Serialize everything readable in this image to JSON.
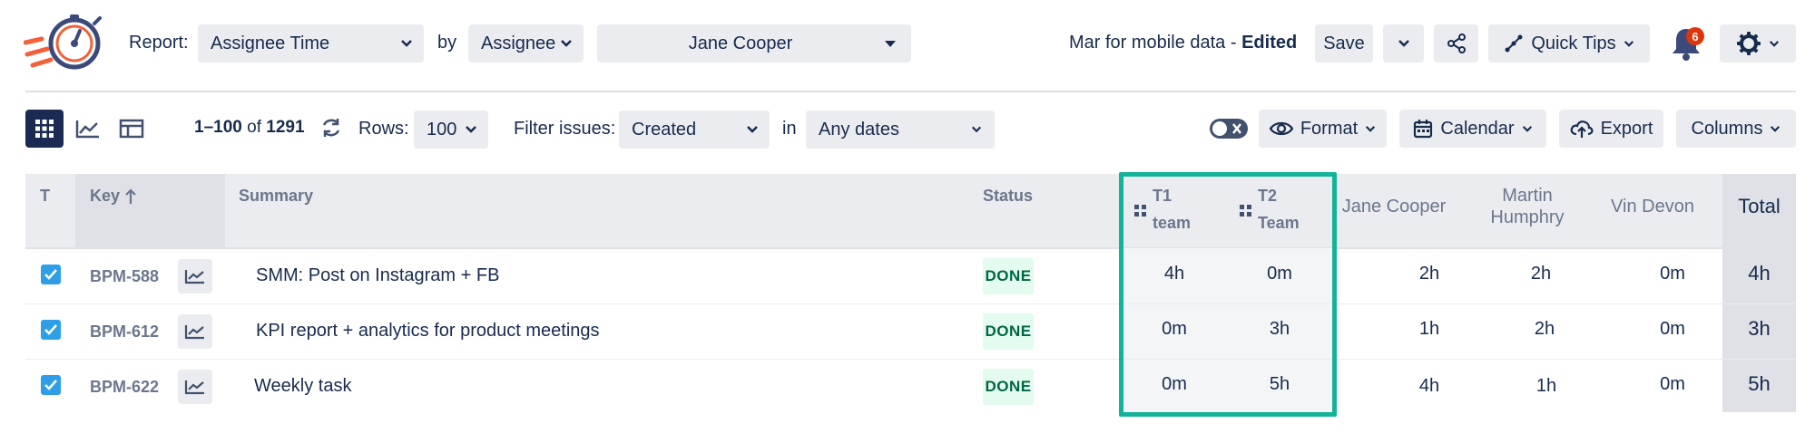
{
  "header": {
    "report_label": "Report:",
    "report_value": "Assignee Time",
    "by_label": "by",
    "by_value": "Assignee",
    "person_value": "Jane Cooper",
    "report_name": "Mar for mobile data - ",
    "report_status": "Edited",
    "save_label": "Save",
    "quick_tips_label": "Quick Tips",
    "notification_count": "6"
  },
  "toolbar": {
    "range_start": "1–100",
    "range_of": "of",
    "range_total": "1291",
    "rows_label": "Rows:",
    "rows_value": "100",
    "filter_label": "Filter issues:",
    "filter_value": "Created",
    "in_label": "in",
    "dates_value": "Any dates",
    "format_label": "Format",
    "calendar_label": "Calendar",
    "export_label": "Export",
    "columns_label": "Columns"
  },
  "table": {
    "headers": {
      "type": "T",
      "key": "Key",
      "summary": "Summary",
      "status": "Status",
      "t1_line1": "T1",
      "t1_line2": "team",
      "t2_line1": "T2",
      "t2_line2": "Team",
      "jane": "Jane Cooper",
      "martin_line1": "Martin",
      "martin_line2": "Humphry",
      "vin": "Vin Devon",
      "total": "Total"
    },
    "rows": [
      {
        "key": "BPM-588",
        "summary": "SMM: Post on Instagram + FB",
        "status": "DONE",
        "t1": "4h",
        "t2": "0m",
        "jane": "2h",
        "martin": "2h",
        "vin": "0m",
        "total": "4h"
      },
      {
        "key": "BPM-612",
        "summary": "KPI report + analytics for product meetings",
        "status": "DONE",
        "t1": "0m",
        "t2": "3h",
        "jane": "1h",
        "martin": "2h",
        "vin": "0m",
        "total": "3h"
      },
      {
        "key": "BPM-622",
        "summary": "Weekly task",
        "status": "DONE",
        "t1": "0m",
        "t2": "5h",
        "jane": "4h",
        "martin": "1h",
        "vin": "0m",
        "total": "5h"
      }
    ]
  },
  "colors": {
    "accent_teal": "#13b39b",
    "checkbox_blue": "#2e9fe6",
    "done_green": "#006644",
    "notification_red": "#de350b",
    "logo_navy": "#3b4a7a",
    "logo_orange": "#f2613a"
  },
  "icons": [
    "stopwatch-logo-icon",
    "chevron-down-icon",
    "share-icon",
    "quick-tips-icon",
    "bell-icon",
    "gear-icon",
    "grid-view-icon",
    "chart-view-icon",
    "panel-view-icon",
    "refresh-icon",
    "toggle-icon",
    "eye-icon",
    "calendar-icon",
    "cloud-upload-icon",
    "sort-up-arrow-icon",
    "drag-handle-icon",
    "trend-icon",
    "checkbox-checked-icon"
  ]
}
